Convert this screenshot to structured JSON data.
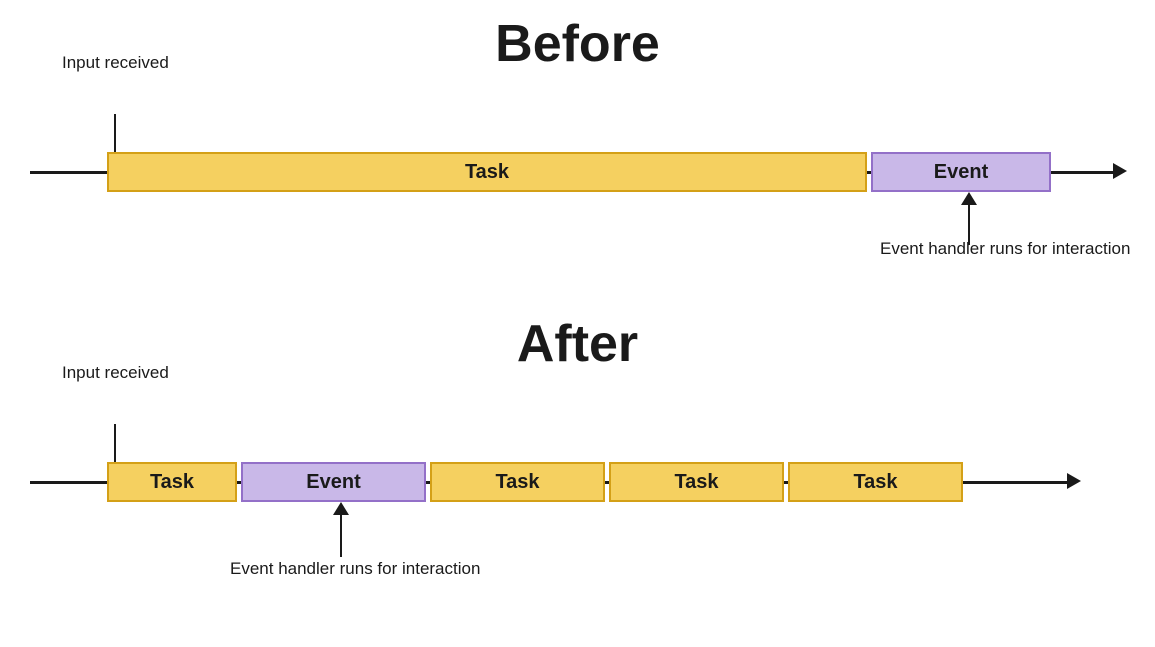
{
  "before": {
    "title": "Before",
    "input_received_label": "Input\nreceived",
    "task_label": "Task",
    "event_label": "Event",
    "event_handler_label": "Event handler\nruns for interaction"
  },
  "after": {
    "title": "After",
    "input_received_label": "Input\nreceived",
    "task_label": "Task",
    "event_label": "Event",
    "task2_label": "Task",
    "task3_label": "Task",
    "task4_label": "Task",
    "event_handler_label": "Event handler\nruns for interaction"
  }
}
